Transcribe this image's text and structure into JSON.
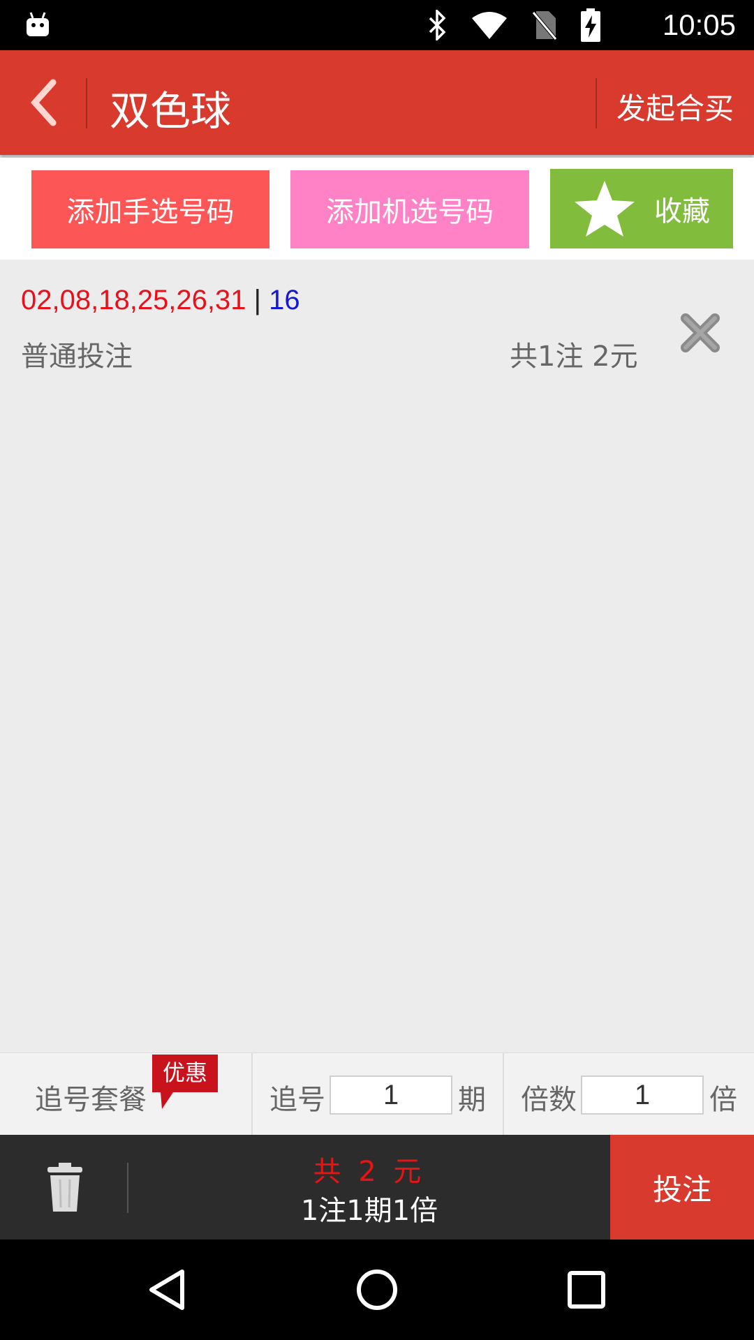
{
  "status_bar": {
    "time": "10:05",
    "icons": [
      "android-debug-icon",
      "bluetooth-icon",
      "wifi-icon",
      "no-sim-icon",
      "battery-charging-icon"
    ]
  },
  "app_bar": {
    "title": "双色球",
    "action_label": "发起合买"
  },
  "buttons": {
    "manual_label": "添加手选号码",
    "random_label": "添加机选号码",
    "favorite_label": "收藏"
  },
  "ticket": {
    "red_numbers": "02,08,18,25,26,31",
    "separator": " | ",
    "blue_number": "16",
    "bet_type": "普通投注",
    "summary": "共1注  2元"
  },
  "chase_bar": {
    "package_label": "追号套餐",
    "badge_label": "优惠",
    "periods_label": "追号",
    "periods_value": "1",
    "periods_unit": "期",
    "multiplier_label": "倍数",
    "multiplier_value": "1",
    "multiplier_unit": "倍"
  },
  "bottom_bar": {
    "total": "共 2 元",
    "detail": "1注1期1倍",
    "submit_label": "投注"
  },
  "colors": {
    "primary": "#d83a2e",
    "manual_button": "#fd5656",
    "random_button": "#ff82c6",
    "favorite_button": "#82bc3c",
    "red_ball": "#e8101a",
    "blue_ball": "#1418d2"
  }
}
